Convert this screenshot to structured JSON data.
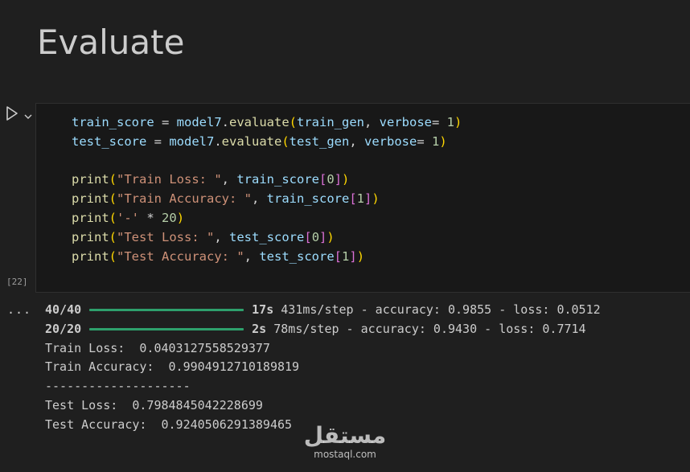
{
  "heading": "Evaluate",
  "cell": {
    "execution_count": "[22]",
    "code_lines": [
      [
        {
          "t": "train_score",
          "c": "v"
        },
        {
          "t": " = ",
          "c": "o"
        },
        {
          "t": "model7",
          "c": "v"
        },
        {
          "t": ".",
          "c": "o"
        },
        {
          "t": "evaluate",
          "c": "fn"
        },
        {
          "t": "(",
          "c": "p1"
        },
        {
          "t": "train_gen",
          "c": "v"
        },
        {
          "t": ", ",
          "c": "o"
        },
        {
          "t": "verbose",
          "c": "v"
        },
        {
          "t": "= ",
          "c": "o"
        },
        {
          "t": "1",
          "c": "n"
        },
        {
          "t": ")",
          "c": "p1"
        }
      ],
      [
        {
          "t": "test_score",
          "c": "v"
        },
        {
          "t": " = ",
          "c": "o"
        },
        {
          "t": "model7",
          "c": "v"
        },
        {
          "t": ".",
          "c": "o"
        },
        {
          "t": "evaluate",
          "c": "fn"
        },
        {
          "t": "(",
          "c": "p1"
        },
        {
          "t": "test_gen",
          "c": "v"
        },
        {
          "t": ", ",
          "c": "o"
        },
        {
          "t": "verbose",
          "c": "v"
        },
        {
          "t": "= ",
          "c": "o"
        },
        {
          "t": "1",
          "c": "n"
        },
        {
          "t": ")",
          "c": "p1"
        }
      ],
      [],
      [
        {
          "t": "print",
          "c": "fn"
        },
        {
          "t": "(",
          "c": "p1"
        },
        {
          "t": "\"Train Loss: \"",
          "c": "s"
        },
        {
          "t": ", ",
          "c": "o"
        },
        {
          "t": "train_score",
          "c": "v"
        },
        {
          "t": "[",
          "c": "p2"
        },
        {
          "t": "0",
          "c": "n"
        },
        {
          "t": "]",
          "c": "p2"
        },
        {
          "t": ")",
          "c": "p1"
        }
      ],
      [
        {
          "t": "print",
          "c": "fn"
        },
        {
          "t": "(",
          "c": "p1"
        },
        {
          "t": "\"Train Accuracy: \"",
          "c": "s"
        },
        {
          "t": ", ",
          "c": "o"
        },
        {
          "t": "train_score",
          "c": "v"
        },
        {
          "t": "[",
          "c": "p2"
        },
        {
          "t": "1",
          "c": "n"
        },
        {
          "t": "]",
          "c": "p2"
        },
        {
          "t": ")",
          "c": "p1"
        }
      ],
      [
        {
          "t": "print",
          "c": "fn"
        },
        {
          "t": "(",
          "c": "p1"
        },
        {
          "t": "'-'",
          "c": "s"
        },
        {
          "t": " * ",
          "c": "o"
        },
        {
          "t": "20",
          "c": "n"
        },
        {
          "t": ")",
          "c": "p1"
        }
      ],
      [
        {
          "t": "print",
          "c": "fn"
        },
        {
          "t": "(",
          "c": "p1"
        },
        {
          "t": "\"Test Loss: \"",
          "c": "s"
        },
        {
          "t": ", ",
          "c": "o"
        },
        {
          "t": "test_score",
          "c": "v"
        },
        {
          "t": "[",
          "c": "p2"
        },
        {
          "t": "0",
          "c": "n"
        },
        {
          "t": "]",
          "c": "p2"
        },
        {
          "t": ")",
          "c": "p1"
        }
      ],
      [
        {
          "t": "print",
          "c": "fn"
        },
        {
          "t": "(",
          "c": "p1"
        },
        {
          "t": "\"Test Accuracy: \"",
          "c": "s"
        },
        {
          "t": ", ",
          "c": "o"
        },
        {
          "t": "test_score",
          "c": "v"
        },
        {
          "t": "[",
          "c": "p2"
        },
        {
          "t": "1",
          "c": "n"
        },
        {
          "t": "]",
          "c": "p2"
        },
        {
          "t": ")",
          "c": "p1"
        }
      ]
    ]
  },
  "output": {
    "more_label": "...",
    "progress_lines": [
      {
        "steps": "40/40",
        "progress": 1.0,
        "time": "17s",
        "rest": " 431ms/step - accuracy: 0.9855 - loss: 0.0512"
      },
      {
        "steps": "20/20",
        "progress": 1.0,
        "time": "2s",
        "rest": " 78ms/step - accuracy: 0.9430 - loss: 0.7714"
      }
    ],
    "text_lines": [
      "Train Loss:  0.0403127558529377",
      "Train Accuracy:  0.9904912710189819",
      "--------------------",
      "Test Loss:  0.7984845042228699",
      "Test Accuracy:  0.9240506291389465"
    ]
  },
  "watermark": {
    "arabic": "مستقل",
    "latin": "mostaql.com"
  },
  "colors": {
    "background": "#1f1f1f",
    "cell_background": "#181818",
    "progress_bar": "#2ea06c"
  }
}
